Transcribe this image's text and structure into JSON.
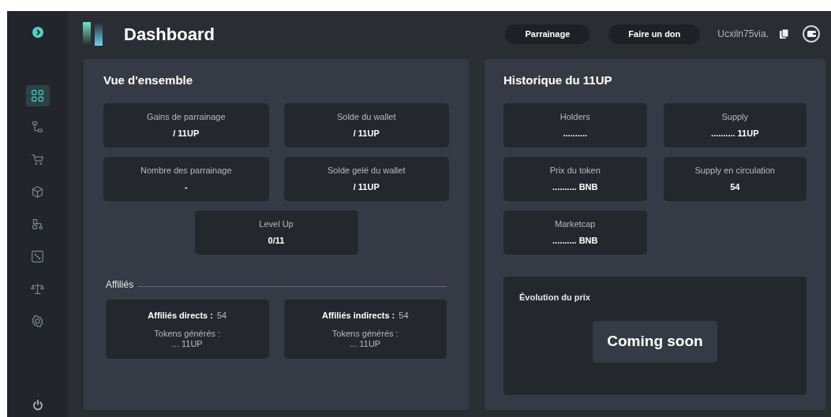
{
  "sidebar": {
    "items": [
      {
        "kind": "grid",
        "selected": true
      },
      {
        "kind": "flow",
        "selected": false
      },
      {
        "kind": "cart",
        "selected": false
      },
      {
        "kind": "cube",
        "selected": false
      },
      {
        "kind": "tractor",
        "selected": false
      },
      {
        "kind": "dice",
        "selected": false
      },
      {
        "kind": "scale",
        "selected": false
      },
      {
        "kind": "gear",
        "selected": false
      }
    ]
  },
  "header": {
    "title": "Dashboard",
    "buttons": [
      "Parrainage",
      "Faire un don"
    ],
    "address": "Ucxiln75via."
  },
  "overview": {
    "title": "Vue d'ensemble",
    "cards": [
      {
        "label": "Gains de parrainage",
        "value": "/ 11UP"
      },
      {
        "label": "Solde du wallet",
        "value": "/ 11UP"
      },
      {
        "label": "Nombre des parrainage",
        "value": "-"
      },
      {
        "label": "Solde gelé du wallet",
        "value": "/ 11UP"
      },
      {
        "label": "Level Up",
        "value": "0/11"
      }
    ],
    "affiliates_title": "Affiliés",
    "affiliates": [
      {
        "label": "Affiliés directs :",
        "count": "54",
        "tokens_label": "Tokens générés :",
        "tokens": "... 11UP"
      },
      {
        "label": "Affiliés indirects :",
        "count": "54",
        "tokens_label": "Tokens générés :",
        "tokens": "... 11UP"
      }
    ]
  },
  "history": {
    "title": "Historique du 11UP",
    "cards": [
      {
        "label": "Holders",
        "value": ".........."
      },
      {
        "label": "Supply",
        "value": ".......... 11UP"
      },
      {
        "label": "Prix du token",
        "value": ".......... BNB"
      },
      {
        "label": "Supply en circulation",
        "value": "54"
      },
      {
        "label": "Marketcap",
        "value": ".......... BNB"
      }
    ],
    "price": {
      "title": "Évolution du prix",
      "message": "Coming soon"
    }
  }
}
